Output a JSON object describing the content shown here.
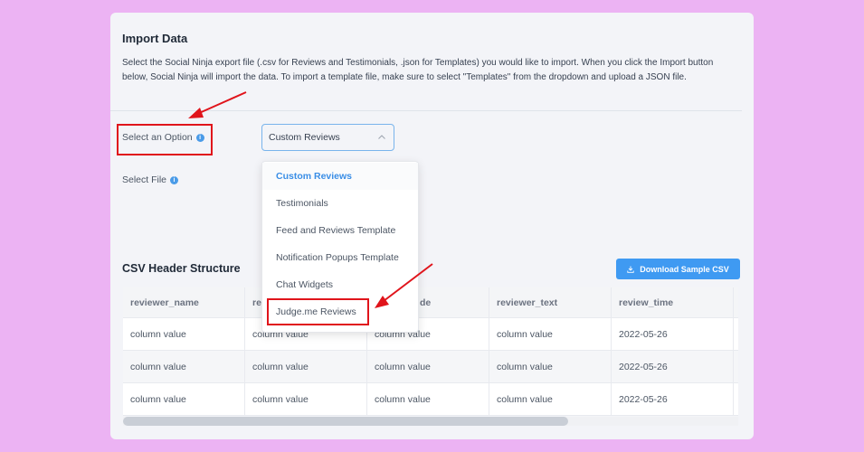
{
  "import": {
    "title": "Import Data",
    "description": "Select the Social Ninja export file (.csv for Reviews and Testimonials, .json for Templates) you would like to import. When you click the Import button below, Social Ninja will import the data. To import a template file, make sure to select \"Templates\" from the dropdown and upload a JSON file."
  },
  "form": {
    "option_label": "Select an Option",
    "file_label": "Select File",
    "select_value": "Custom Reviews",
    "options": [
      "Custom Reviews",
      "Testimonials",
      "Feed and Reviews Template",
      "Notification Popups Template",
      "Chat Widgets",
      "Judge.me Reviews"
    ]
  },
  "csv": {
    "title": "CSV Header Structure",
    "download_label": "Download Sample CSV",
    "columns": [
      "reviewer_name",
      "re",
      "de",
      "reviewer_text",
      "review_time"
    ],
    "rows": [
      [
        "column value",
        "column value",
        "column value",
        "column value",
        "2022-05-26"
      ],
      [
        "column value",
        "column value",
        "column value",
        "column value",
        "2022-05-26"
      ],
      [
        "column value",
        "column value",
        "column value",
        "column value",
        "2022-05-26"
      ]
    ]
  },
  "icons": {
    "info": "info-icon",
    "chevron": "chevron-up-icon",
    "download": "download-icon"
  },
  "colors": {
    "background": "#ecb3f3",
    "accent": "#3f9af2",
    "highlight": "#e0141b"
  }
}
